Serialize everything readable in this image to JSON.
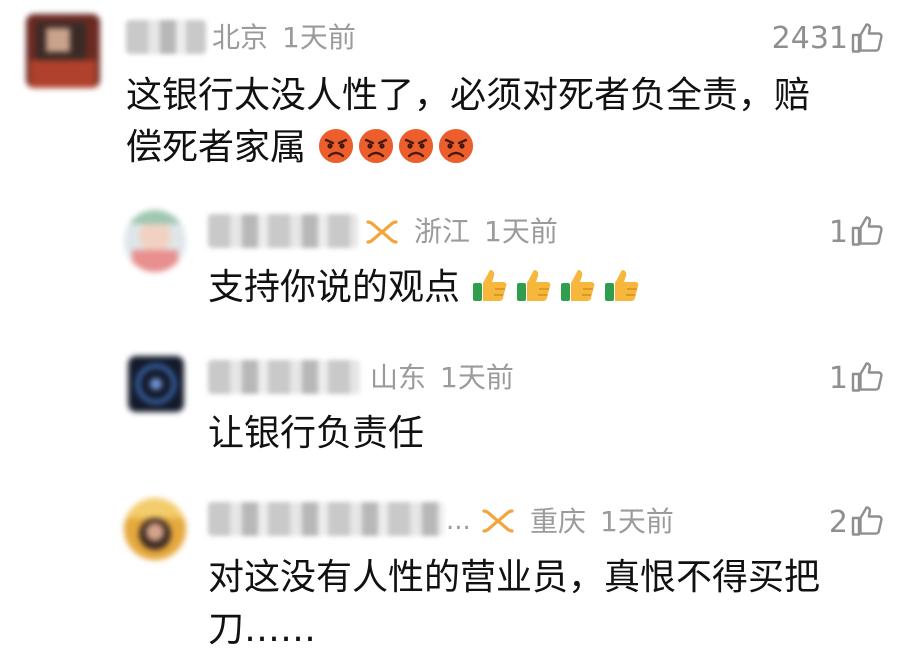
{
  "colors": {
    "meta": "#9b9b9b",
    "text": "#111111",
    "badge": "#f3a53a",
    "angry": "#e74c2e",
    "thumb": "#f6b73c"
  },
  "comments": [
    {
      "location": "北京",
      "time": "1天前",
      "likes": "2431",
      "text_lines": [
        "这银行太没人性了，必须对死者负全责，赔",
        "偿死者家属"
      ],
      "emoji_names": [
        "angry-face",
        "angry-face",
        "angry-face",
        "angry-face"
      ]
    },
    {
      "location": "浙江",
      "time": "1天前",
      "likes": "1",
      "text_lines": [
        "支持你说的观点"
      ],
      "emoji_names": [
        "thumbs-up",
        "thumbs-up",
        "thumbs-up",
        "thumbs-up"
      ]
    },
    {
      "location": "山东",
      "time": "1天前",
      "likes": "1",
      "text_lines": [
        "让银行负责任"
      ]
    },
    {
      "location": "重庆",
      "time": "1天前",
      "likes": "2",
      "name_suffix": "...",
      "text_lines": [
        "对这没有人性的营业员，真恨不得买把",
        "刀……"
      ]
    }
  ]
}
